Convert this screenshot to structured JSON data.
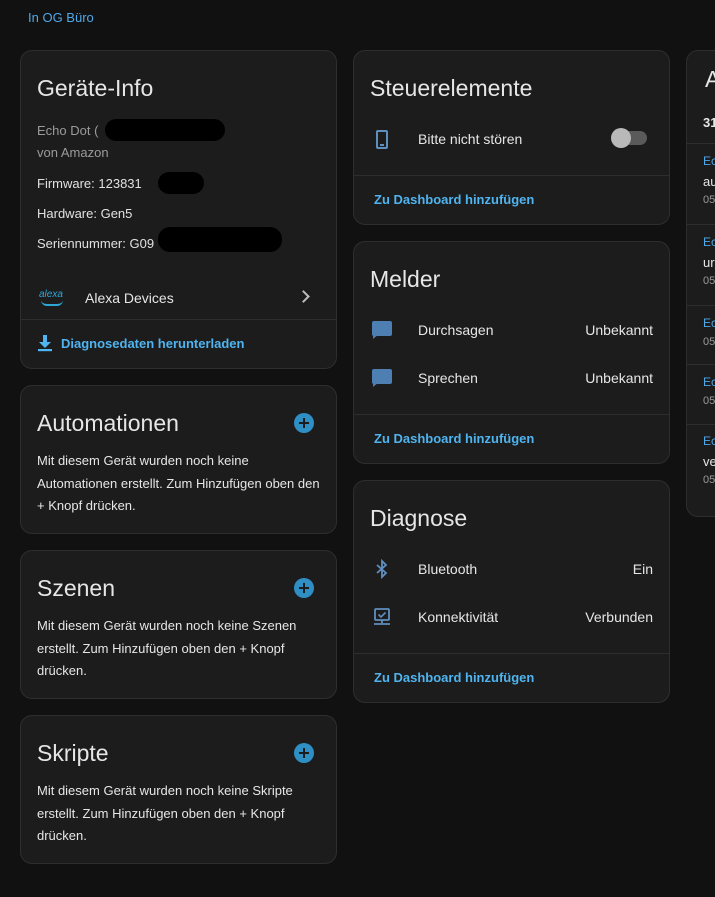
{
  "area_link": "In OG Büro",
  "device_info": {
    "title": "Geräte-Info",
    "model": "Echo Dot (",
    "manufacturer": "von Amazon",
    "firmware": "Firmware: 123831",
    "hardware": "Hardware: Gen5",
    "serial": "Seriennummer: G09",
    "integration_logo_text": "alexa",
    "integration": "Alexa Devices",
    "download_link": "Diagnosedaten herunterladen"
  },
  "automations": {
    "title": "Automationen",
    "text": "Mit diesem Gerät wurden noch keine Automationen erstellt. Zum Hinzufügen oben den + Knopf drücken."
  },
  "scenes": {
    "title": "Szenen",
    "text": "Mit diesem Gerät wurden noch keine Szenen erstellt. Zum Hinzufügen oben den + Knopf drücken."
  },
  "scripts": {
    "title": "Skripte",
    "text": "Mit diesem Gerät wurden noch keine Skripte erstellt. Zum Hinzufügen oben den + Knopf drücken."
  },
  "controls": {
    "title": "Steuerelemente",
    "items": [
      {
        "label": "Bitte nicht stören",
        "icon": "cellphone-icon",
        "state": "off"
      }
    ],
    "add_link": "Zu Dashboard hinzufügen"
  },
  "sensors": {
    "title": "Melder",
    "items": [
      {
        "label": "Durchsagen",
        "value": "Unbekannt",
        "icon": "message-icon"
      },
      {
        "label": "Sprechen",
        "value": "Unbekannt",
        "icon": "message-icon"
      }
    ],
    "add_link": "Zu Dashboard hinzufügen"
  },
  "diagnostics": {
    "title": "Diagnose",
    "items": [
      {
        "label": "Bluetooth",
        "value": "Ein",
        "icon": "bluetooth-icon"
      },
      {
        "label": "Konnektivität",
        "value": "Verbunden",
        "icon": "network-icon"
      }
    ],
    "add_link": "Zu Dashboard hinzufügen"
  },
  "activity": {
    "title": "A",
    "subtitle": "31",
    "entries": [
      {
        "a": "Ec",
        "b": "au",
        "c": "05"
      },
      {
        "a": "Ec",
        "b": "ur",
        "c": "05"
      },
      {
        "a": "Ec",
        "b": "",
        "c": "05"
      },
      {
        "a": "Ec",
        "b": "",
        "c": "05"
      },
      {
        "a": "Ec",
        "b": "ve",
        "c": "05"
      }
    ]
  },
  "colors": {
    "background": "#111111",
    "card": "#1c1c1c",
    "accent": "#4fb4ef",
    "icon": "#4d7fb3"
  }
}
